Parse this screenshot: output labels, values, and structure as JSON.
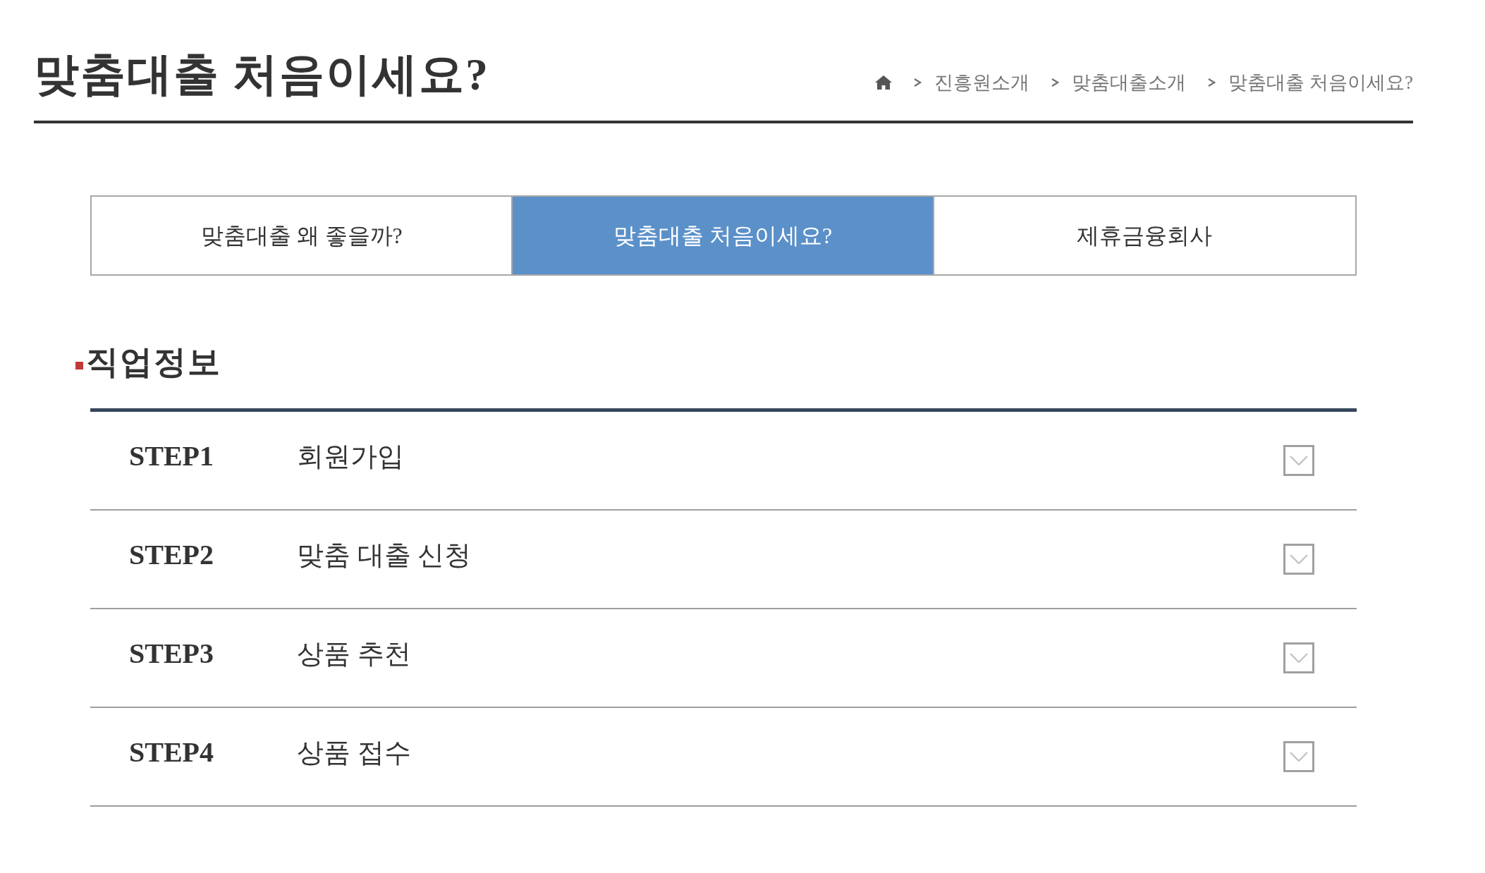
{
  "page": {
    "title": "맞춤대출 처음이세요?"
  },
  "breadcrumb": {
    "items": [
      "진흥원소개",
      "맞춤대출소개",
      "맞춤대출 처음이세요?"
    ]
  },
  "tabs": [
    {
      "label": "맞춤대출 왜 좋을까?",
      "selected": false
    },
    {
      "label": "맞춤대출 처음이세요?",
      "selected": true
    },
    {
      "label": "제휴금융회사",
      "selected": false
    }
  ],
  "section": {
    "title": "직업정보"
  },
  "steps": [
    {
      "step": "STEP1",
      "title": "회원가입",
      "expanded": false
    },
    {
      "step": "STEP2",
      "title": "맞춤 대출 신청",
      "expanded": false
    },
    {
      "step": "STEP3",
      "title": "상품 추천",
      "expanded": false
    },
    {
      "step": "STEP4",
      "title": "상품 접수",
      "expanded": false
    }
  ]
}
